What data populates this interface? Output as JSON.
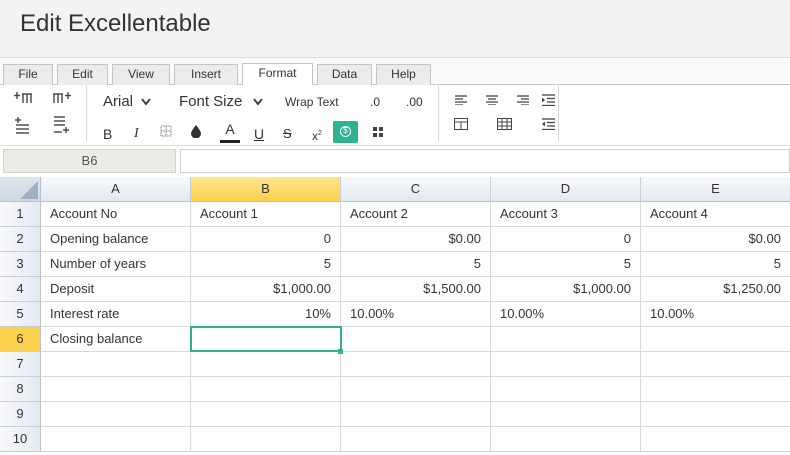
{
  "app": {
    "title": "Edit Excellentable"
  },
  "tabs": [
    {
      "label": "File",
      "active": false
    },
    {
      "label": "Edit",
      "active": false
    },
    {
      "label": "View",
      "active": false
    },
    {
      "label": "Insert",
      "active": false
    },
    {
      "label": "Format",
      "active": true
    },
    {
      "label": "Data",
      "active": false
    },
    {
      "label": "Help",
      "active": false
    }
  ],
  "ribbon": {
    "font_name": "Arial",
    "font_size_label": "Font Size",
    "wrap_text_label": "Wrap Text",
    "decimal_decrease_label": ".0",
    "decimal_increase_label": ".00",
    "bold_label": "B",
    "italic_label": "I",
    "font_color_label": "A",
    "underline_label": "U",
    "strikethrough_label": "S",
    "superscript_label": "x",
    "currency_label": "$",
    "accent_color": "#2fb38e"
  },
  "formula_bar": {
    "cell_ref": "B6",
    "formula": ""
  },
  "grid": {
    "columns": [
      "A",
      "B",
      "C",
      "D",
      "E"
    ],
    "selected_column": "B",
    "selected_row": 6,
    "selected_cell": "B6",
    "rows": [
      {
        "num": "1",
        "cells": [
          "Account No",
          "Account 1",
          "Account 2",
          "Account 3",
          "Account 4"
        ]
      },
      {
        "num": "2",
        "cells": [
          "Opening balance",
          "0",
          "$0.00",
          "0",
          "$0.00"
        ]
      },
      {
        "num": "3",
        "cells": [
          "Number of years",
          "5",
          "5",
          "5",
          "5"
        ]
      },
      {
        "num": "4",
        "cells": [
          "Deposit",
          "$1,000.00",
          "$1,500.00",
          "$1,000.00",
          "$1,250.00"
        ]
      },
      {
        "num": "5",
        "cells": [
          "Interest rate",
          "10%",
          "10.00%",
          "10.00%",
          "10.00%"
        ]
      },
      {
        "num": "6",
        "cells": [
          "Closing balance",
          "",
          "",
          "",
          ""
        ]
      },
      {
        "num": "7",
        "cells": [
          "",
          "",
          "",
          "",
          ""
        ]
      },
      {
        "num": "8",
        "cells": [
          "",
          "",
          "",
          "",
          ""
        ]
      },
      {
        "num": "9",
        "cells": [
          "",
          "",
          "",
          "",
          ""
        ]
      },
      {
        "num": "10",
        "cells": [
          "",
          "",
          "",
          "",
          ""
        ]
      }
    ]
  }
}
